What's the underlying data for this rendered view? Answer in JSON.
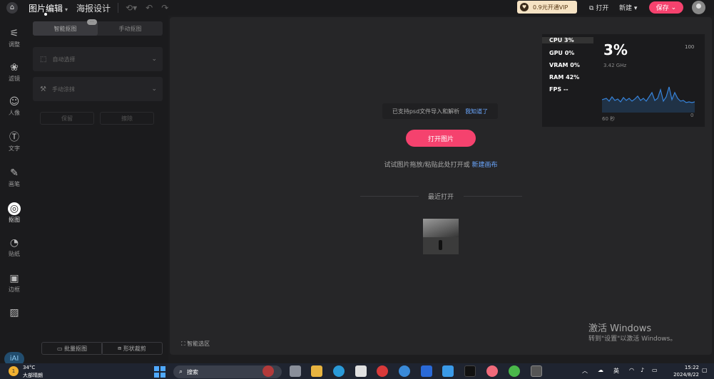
{
  "topbar": {
    "home_icon": "home-icon",
    "tabs": [
      {
        "label": "图片编辑",
        "active": true
      },
      {
        "label": "海报设计",
        "active": false
      }
    ],
    "vip_label": "0.9元开通VIP",
    "open_label": "打开",
    "new_label": "新建",
    "save_label": "保存"
  },
  "left_nav": [
    {
      "label": "调整",
      "icon": "sliders-icon"
    },
    {
      "label": "滤镜",
      "icon": "filter-icon"
    },
    {
      "label": "人像",
      "icon": "person-icon"
    },
    {
      "label": "文字",
      "icon": "text-icon"
    },
    {
      "label": "画笔",
      "icon": "brush-icon"
    },
    {
      "label": "抠图",
      "icon": "cutout-icon",
      "active": true
    },
    {
      "label": "贴纸",
      "icon": "sticker-icon"
    },
    {
      "label": "边框",
      "icon": "frame-icon"
    },
    {
      "label": "",
      "icon": "texture-icon"
    }
  ],
  "panel": {
    "seg_smart": "智能抠图",
    "seg_manual": "手动抠图",
    "auto_select": "自动选择",
    "manual_paint": "手动涂抹",
    "keep": "保留",
    "erase": "擦除",
    "batch": "批量抠图",
    "shape": "形状裁剪"
  },
  "canvas": {
    "notice_text": "已支持psd文件导入和解析",
    "notice_link": "我知道了",
    "open_button": "打开图片",
    "hint_text": "试试图片拖放/粘贴此处打开或",
    "hint_link": "新建画布",
    "recent_label": "最近打开",
    "smart_select": "智能选区"
  },
  "perf": {
    "cpu": "CPU  3%",
    "gpu": "GPU  0%",
    "vram": "VRAM  0%",
    "ram": "RAM  42%",
    "fps": "FPS --",
    "big": "3%",
    "ghz": "3.42 GHz",
    "max": "100",
    "span": "60 秒",
    "min": "0"
  },
  "watermark": {
    "line1": "激活 Windows",
    "line2": "转到\"设置\"以激活 Windows。"
  },
  "taskbar": {
    "badge": "1",
    "temp": "34°C",
    "weather": "大部晴朗",
    "search": "搜索",
    "lang": "英",
    "time": "15:22",
    "date": "2024/8/22"
  },
  "colors": {
    "accent": "#f5426e",
    "link": "#6aa7ff",
    "vip_bg": "#f6e3c4"
  }
}
